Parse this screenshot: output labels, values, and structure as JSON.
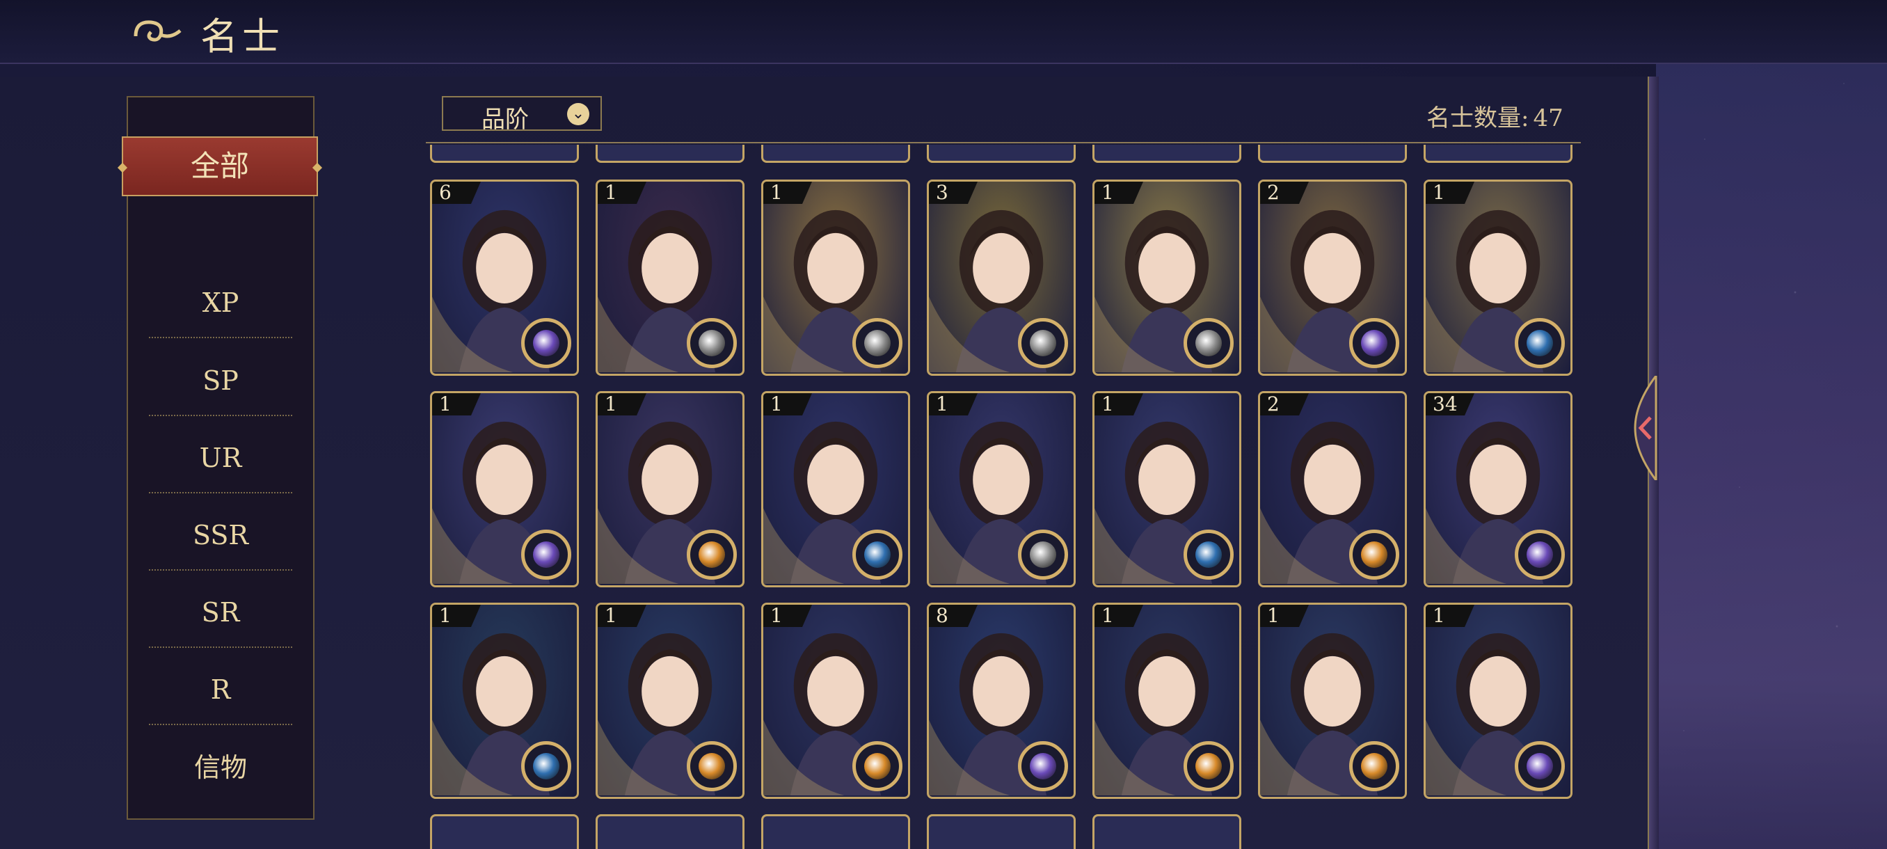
{
  "header": {
    "title": "名士"
  },
  "toolbar": {
    "sort_label": "品阶",
    "count_label": "名士数量:",
    "count_value": "47"
  },
  "filters": {
    "active": "全部",
    "items": [
      "XP",
      "SP",
      "UR",
      "SSR",
      "SR",
      "R",
      "信物"
    ]
  },
  "colors": {
    "gold": "#c4a565",
    "active_red": "#8a2e26",
    "panel": "#1b1b38"
  },
  "cards": [
    {
      "count": "6",
      "element": "purple-orb-icon",
      "bg": "#2d3366"
    },
    {
      "count": "1",
      "element": "compass-icon",
      "bg": "#3a2a4a"
    },
    {
      "count": "1",
      "element": "compass-icon",
      "bg": "#8a7040"
    },
    {
      "count": "3",
      "element": "compass-icon",
      "bg": "#7a6a3a"
    },
    {
      "count": "1",
      "element": "compass-icon",
      "bg": "#8a7a48"
    },
    {
      "count": "2",
      "element": "purple-orb-icon",
      "bg": "#7a6540"
    },
    {
      "count": "1",
      "element": "blue-orb-icon",
      "bg": "#7a6a48"
    },
    {
      "count": "1",
      "element": "purple-orb-icon",
      "bg": "#3a3b70"
    },
    {
      "count": "1",
      "element": "sun-icon",
      "bg": "#3a3560"
    },
    {
      "count": "1",
      "element": "blue-orb-icon",
      "bg": "#2e3366"
    },
    {
      "count": "1",
      "element": "compass-icon",
      "bg": "#343668"
    },
    {
      "count": "1",
      "element": "blue-orb-icon",
      "bg": "#33386a"
    },
    {
      "count": "2",
      "element": "sun-icon",
      "bg": "#2a2d5c"
    },
    {
      "count": "34",
      "element": "purple-orb-icon",
      "bg": "#3b3a72"
    },
    {
      "count": "1",
      "element": "blue-orb-icon",
      "bg": "#263a5a"
    },
    {
      "count": "1",
      "element": "sun-icon",
      "bg": "#283a62"
    },
    {
      "count": "1",
      "element": "sun-icon",
      "bg": "#2c3460"
    },
    {
      "count": "8",
      "element": "purple-orb-icon",
      "bg": "#2a3a6a"
    },
    {
      "count": "1",
      "element": "sun-icon",
      "bg": "#2a3660"
    },
    {
      "count": "1",
      "element": "sun-icon",
      "bg": "#2b3a62"
    },
    {
      "count": "1",
      "element": "purple-orb-icon",
      "bg": "#2d3a64"
    }
  ]
}
